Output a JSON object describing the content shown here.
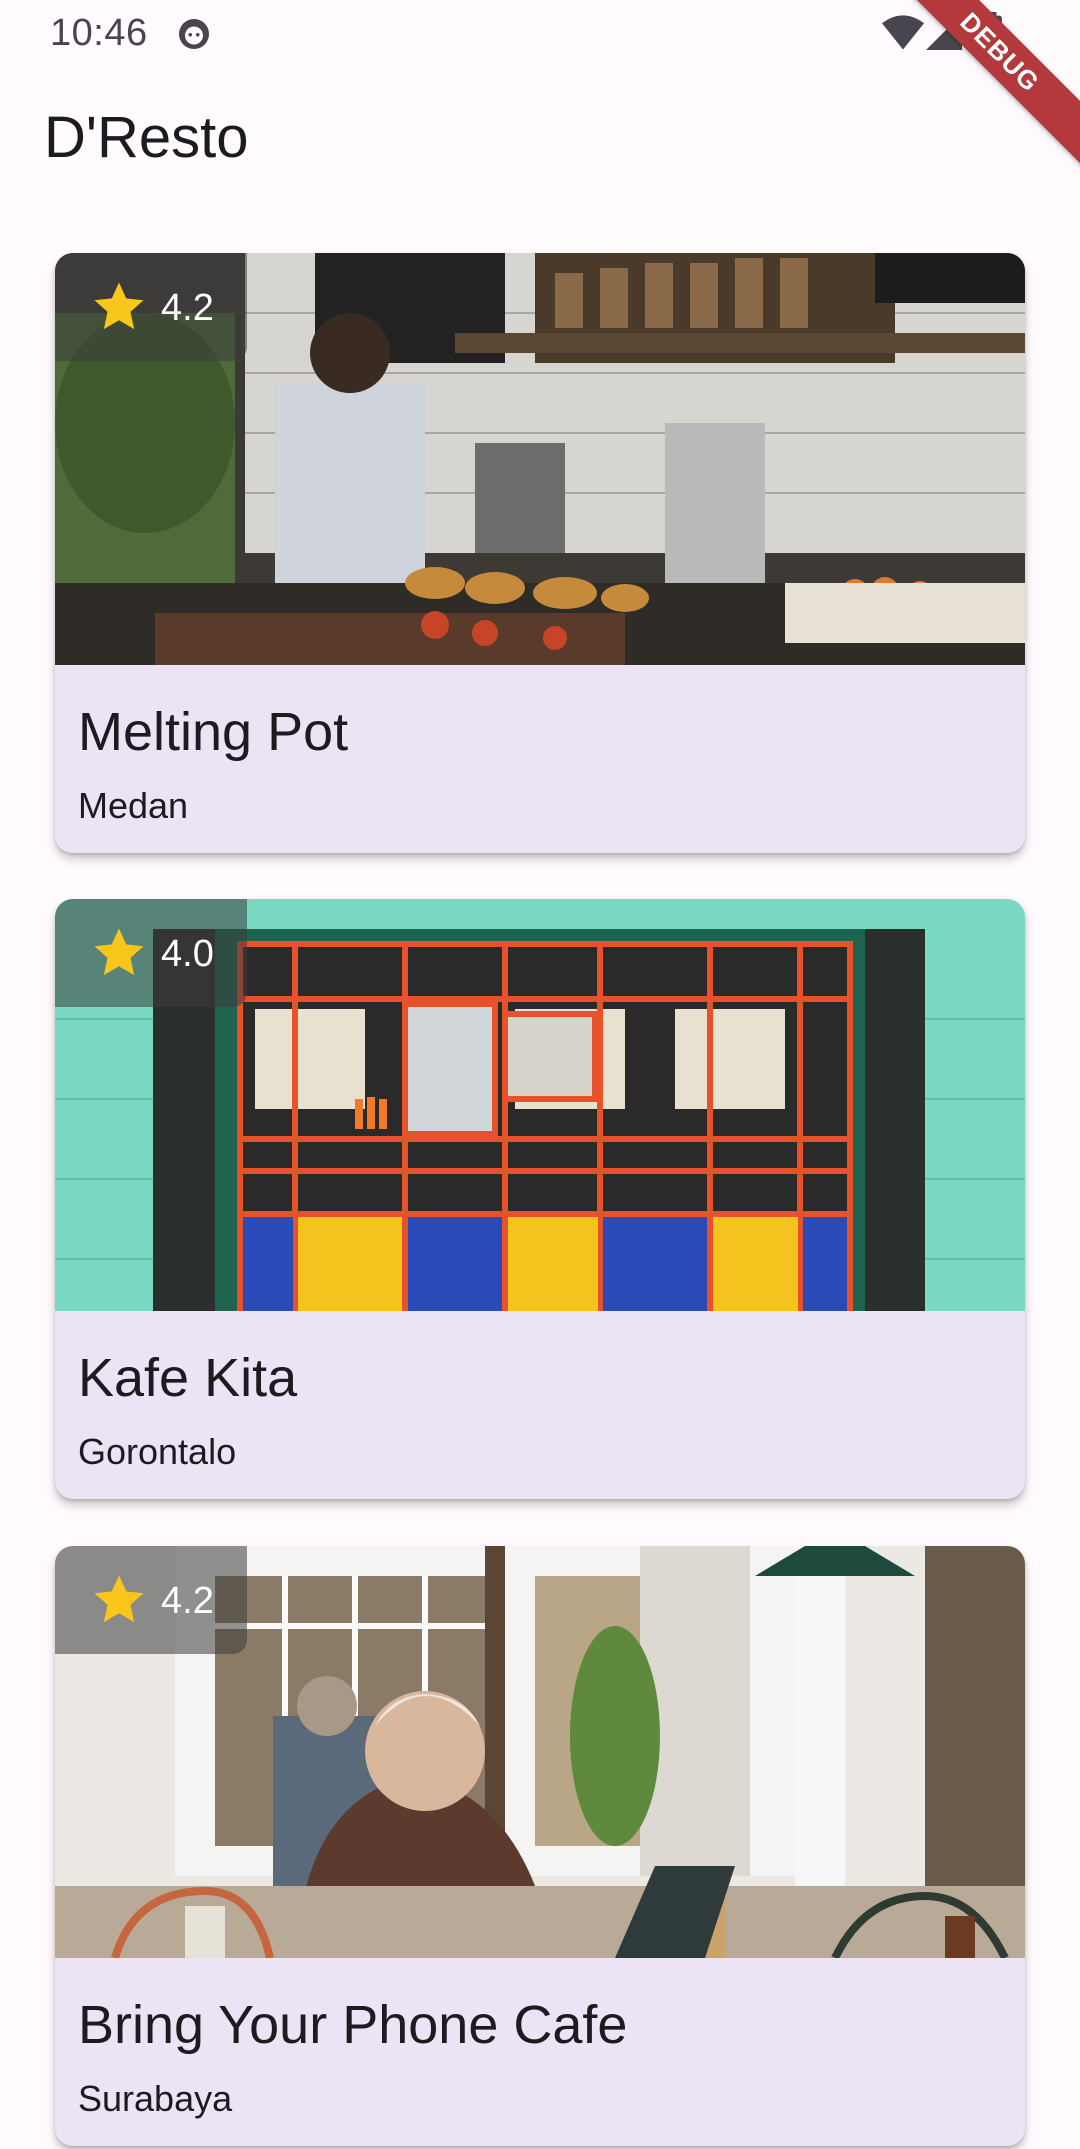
{
  "status_bar": {
    "time": "10:46",
    "app_icon": "android-debug-icon",
    "wifi_icon": "wifi-icon",
    "signal_icon": "cell-signal-icon",
    "battery_icon": "battery-icon"
  },
  "debug_banner": "DEBUG",
  "app_bar": {
    "title": "D'Resto"
  },
  "colors": {
    "background": "#fffbfe",
    "card_background": "#ece3f4",
    "star": "#f9c71c",
    "debug_banner": "#b4393c"
  },
  "restaurants": [
    {
      "name": "Melting Pot",
      "city": "Medan",
      "rating": "4.2",
      "image": "cafe-counter-photo"
    },
    {
      "name": "Kafe Kita",
      "city": "Gorontalo",
      "rating": "4.0",
      "image": "colorful-storefront-photo"
    },
    {
      "name": "Bring Your Phone Cafe",
      "city": "Surabaya",
      "rating": "4.2",
      "image": "cafe-interior-photo"
    }
  ]
}
